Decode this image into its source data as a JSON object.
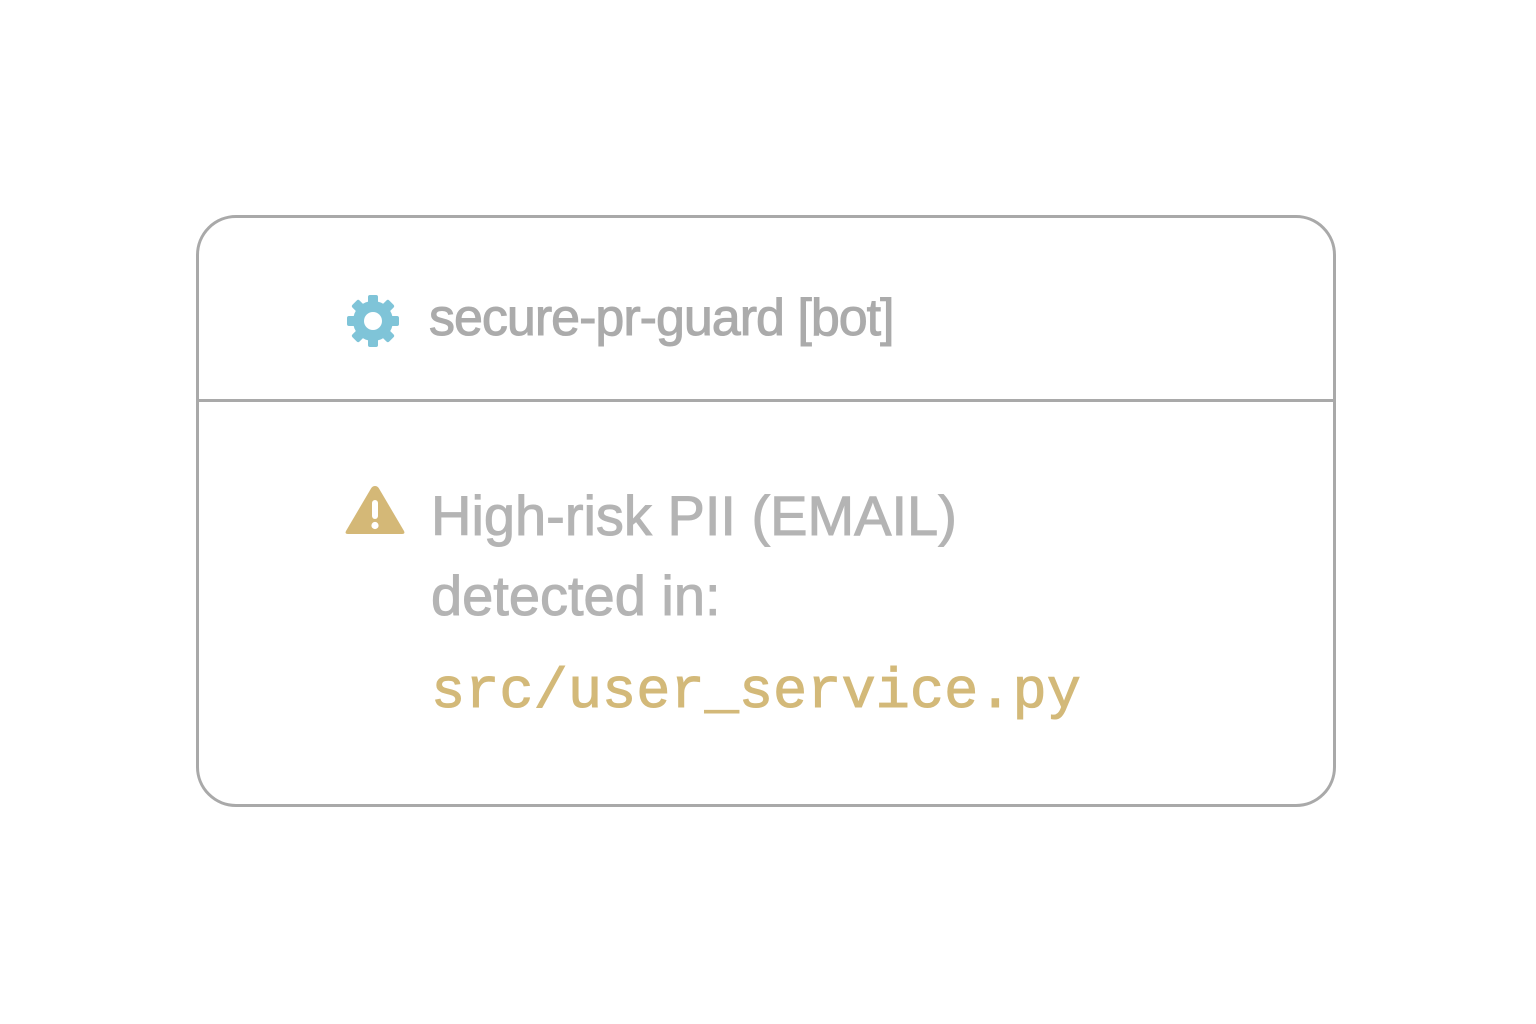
{
  "bot": {
    "icon": "gear-icon",
    "name": "secure-pr-guard [bot]"
  },
  "alert": {
    "icon": "warning-icon",
    "line1": "High-risk PII (EMAIL)",
    "line2": "detected in:",
    "file_path": "src/user_service.py"
  },
  "colors": {
    "gear": "#7fc4d8",
    "warning": "#d4b877",
    "file_path": "#d3b979",
    "text": "#b4b4b4",
    "border": "#a9a9a9"
  }
}
